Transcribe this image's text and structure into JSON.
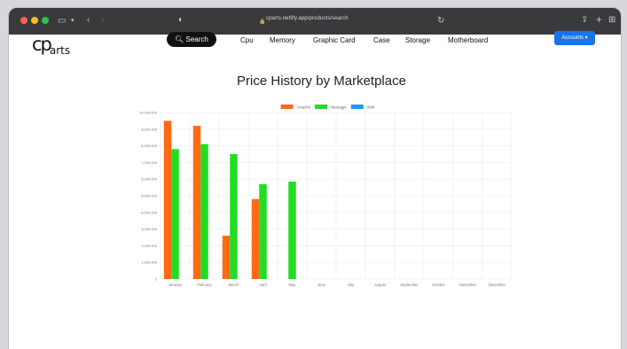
{
  "browser": {
    "url": "cparts.netlify.app/products/search"
  },
  "site": {
    "logo_big": "cp",
    "logo_small": "arts",
    "search_label": "Search",
    "nav": [
      "Cpu",
      "Memory",
      "Graphic Card",
      "Case",
      "Storage",
      "Motherboard"
    ],
    "accounts_label": "Accounts"
  },
  "colors": {
    "titlebar": "#3a393c",
    "amazon": "#ff6a13",
    "neweggs": "#22dd22",
    "walt": "#1e9bf0",
    "accounts": "#1a73e8"
  },
  "chart_data": {
    "type": "bar",
    "title": "Price History by Marketplace",
    "categories": [
      "January",
      "February",
      "March",
      "April",
      "May",
      "June",
      "July",
      "August",
      "September",
      "October",
      "November",
      "December"
    ],
    "series": [
      {
        "name": "Amazon",
        "color": "#ff6a13",
        "values": [
          9500000,
          9200000,
          2600000,
          4800000,
          null,
          null,
          null,
          null,
          null,
          null,
          null,
          null
        ]
      },
      {
        "name": "Neweggs",
        "color": "#22dd22",
        "values": [
          7800000,
          8100000,
          7500000,
          5700000,
          5850000,
          null,
          null,
          null,
          null,
          null,
          null,
          null
        ]
      },
      {
        "name": "Walt",
        "color": "#1e9bf0",
        "values": [
          null,
          null,
          null,
          null,
          null,
          null,
          null,
          null,
          null,
          null,
          null,
          null
        ]
      }
    ],
    "ylim": [
      0,
      10000000
    ],
    "yticks": [
      "0",
      "1,000,000",
      "2,000,000",
      "3,000,000",
      "4,000,000",
      "5,000,000",
      "6,000,000",
      "7,000,000",
      "8,000,000",
      "9,000,000",
      "10,000,000"
    ],
    "grid": true,
    "legend": "top"
  }
}
